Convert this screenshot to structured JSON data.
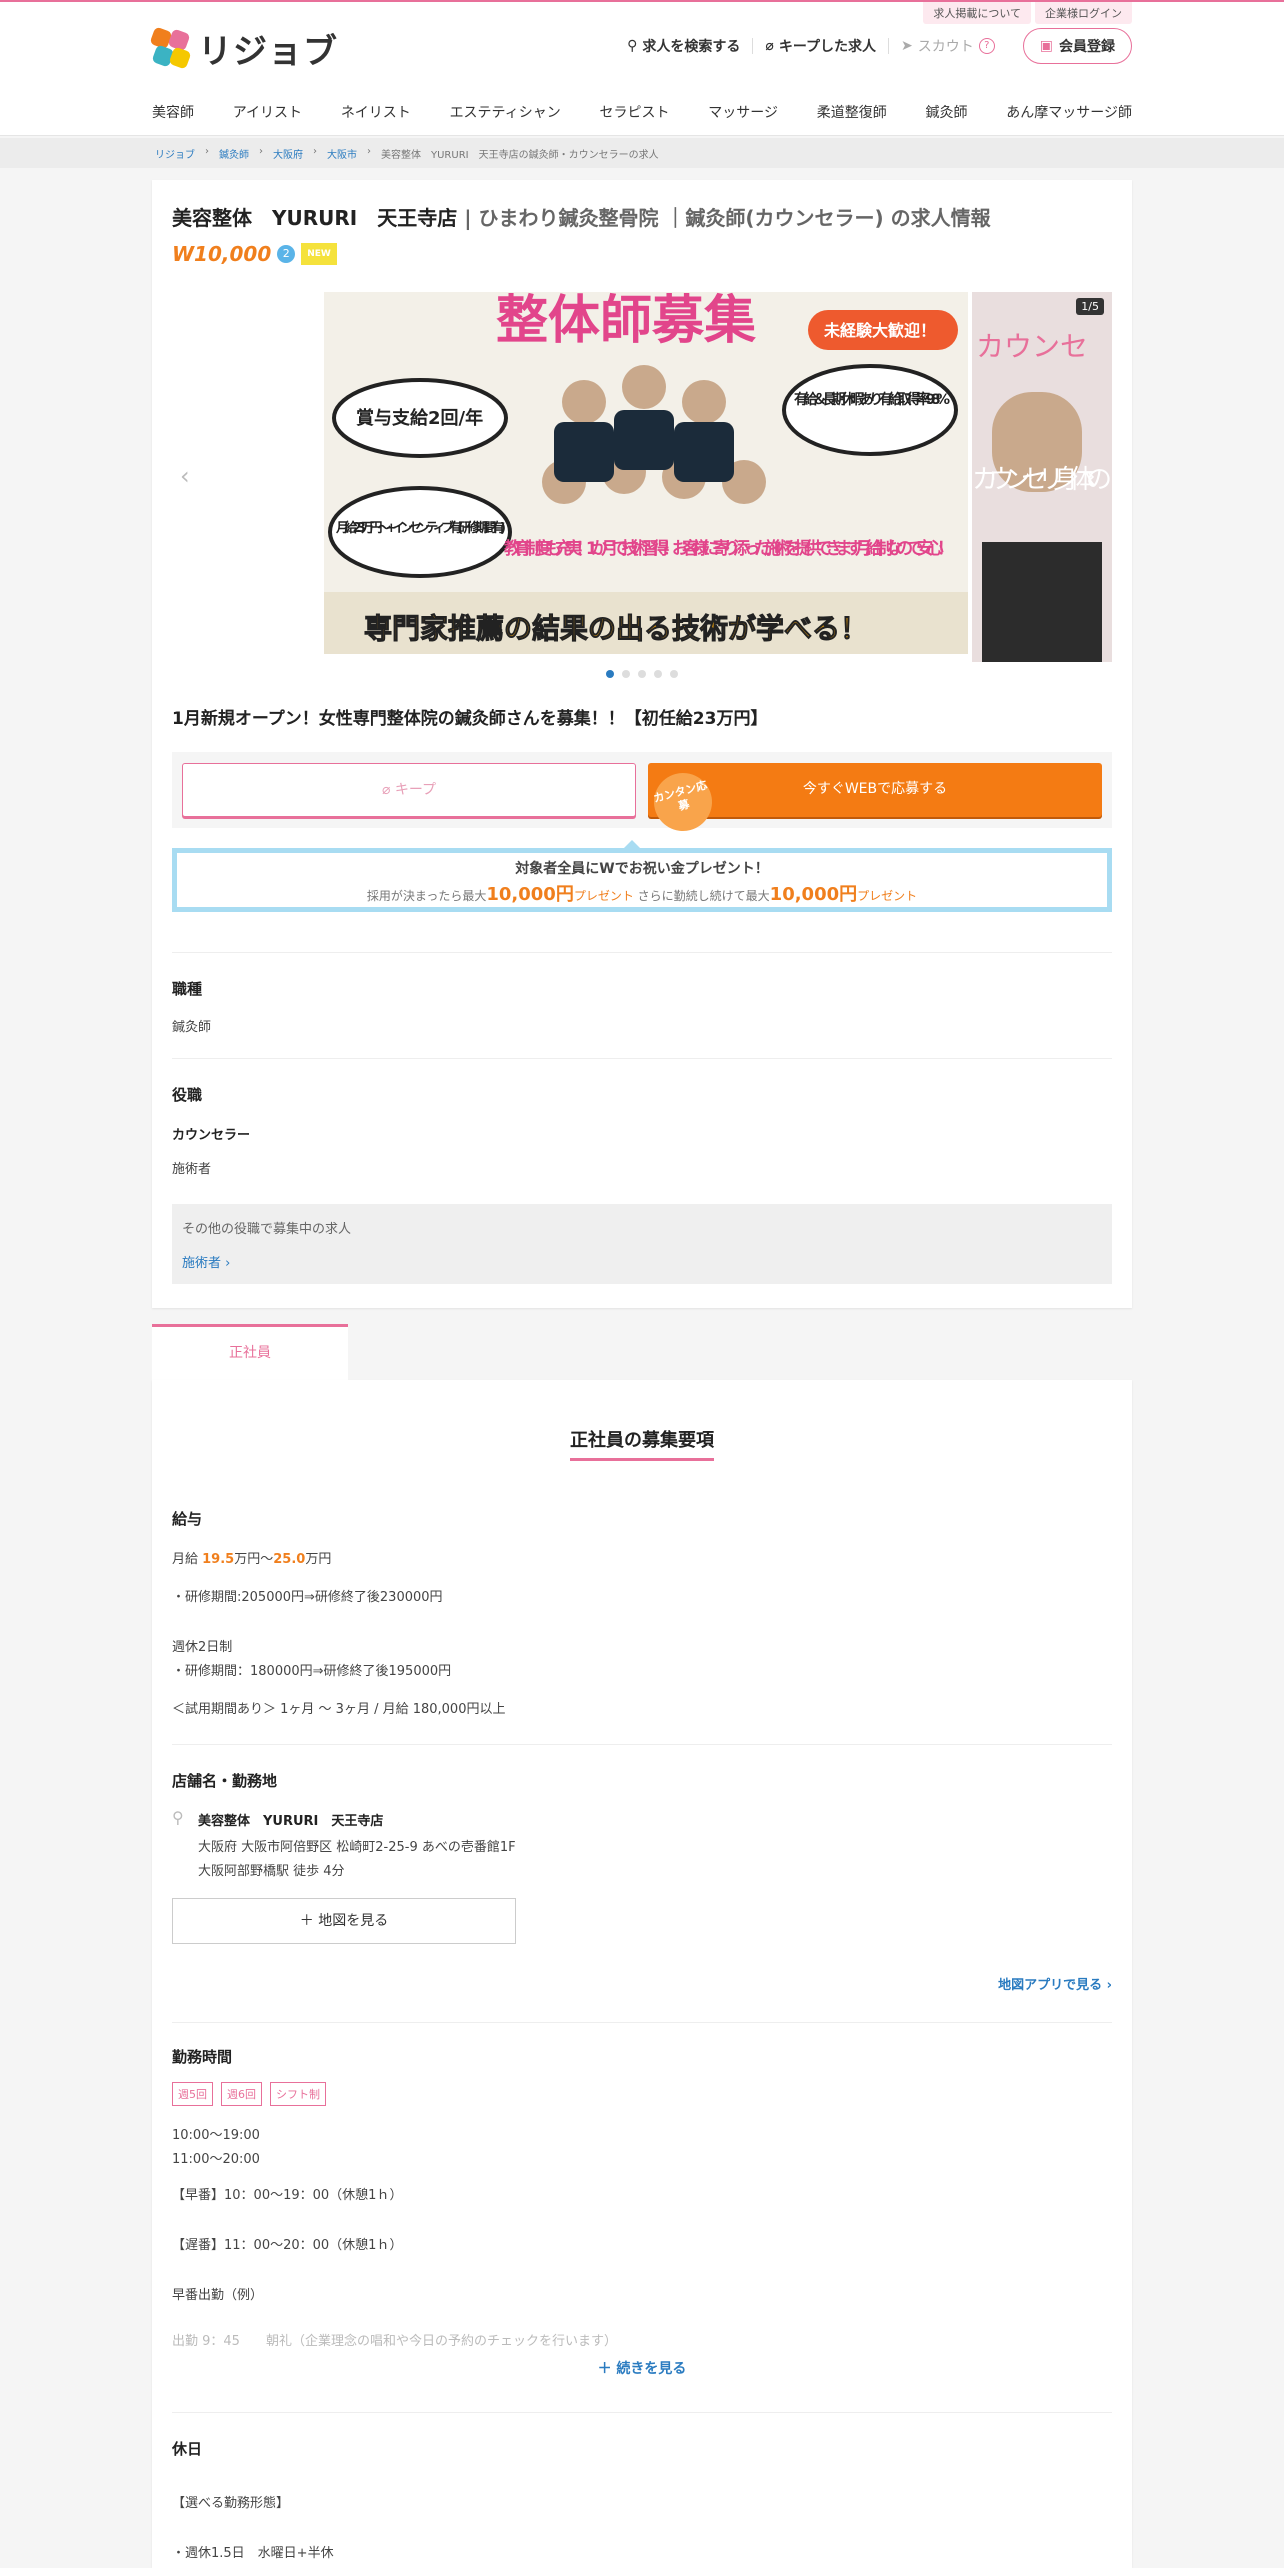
{
  "header": {
    "logo_text": "リジョブ",
    "util_links": [
      "求人掲載について",
      "企業様ログイン"
    ],
    "nav": {
      "search": "求人を検索する",
      "kept": "キープした求人",
      "scout": "スカウト",
      "scout_help": "?",
      "member": "会員登録"
    },
    "categories": [
      "美容師",
      "アイリスト",
      "ネイリスト",
      "エステティシャン",
      "セラピスト",
      "マッサージ",
      "柔道整復師",
      "鍼灸師",
      "あん摩マッサージ師"
    ]
  },
  "breadcrumb": [
    "リジョブ",
    "鍼灸師",
    "大阪府",
    "大阪市",
    "美容整体　YURURI　天王寺店の鍼灸師・カウンセラーの求人"
  ],
  "job": {
    "title_store": "美容整体　YURURI　天王寺店",
    "title_rest": "| ひまわり鍼灸整骨院 ｜鍼灸師(カウンセラー) の求人情報",
    "w_badge": "W10,000",
    "w_badge_num": "2",
    "new_badge": "NEW",
    "slide_counter": "1/5",
    "slide_texts": {
      "headline": "整体師募集",
      "inexp": "未経験大歓迎！",
      "bonus": "賞与支給2回/年",
      "holiday": "有給＆長期休暇あり 有給取得率98%",
      "salary": "月給23万円～ +インセンティブ有 (研修期間有)",
      "edu": "教育制度も充実！1か月で技術習得！ お客様に寄り添った施術を提供できます 月給制なので安心！",
      "bottom": "専門家推薦の結果の出る技術が学べる！",
      "side1": "カウンセ",
      "side2": "カウンセリ 身体の"
    },
    "catch": "1月新規オープン！女性専門整体院の鍼灸師さんを募集！！【初任給23万円】",
    "keep_label": "キープ",
    "apply_label": "今すぐWEBで応募する",
    "easy_label": "カンタン応募",
    "present": {
      "line1": "対象者全員にWでお祝い金プレゼント！",
      "a": "採用が決まったら最大",
      "amount1": "10,000円",
      "b": "プレゼント",
      "c": " さらに勤続し続けて最大",
      "amount2": "10,000円",
      "d": "プレゼント"
    },
    "shokushu_h": "職種",
    "shokushu": "鍼灸師",
    "yakushoku_h": "役職",
    "yakushoku_1": "カウンセラー",
    "yakushoku_2": "施術者",
    "other_roles_label": "その他の役職で募集中の求人",
    "other_roles_link": "施術者 ›"
  },
  "tab_label": "正社員",
  "details": {
    "section_title": "正社員の募集要項",
    "salary_h": "給与",
    "salary_pre": "月給 ",
    "salary_min": "19.5",
    "salary_mid": "万円〜",
    "salary_max": "25.0",
    "salary_post": "万円",
    "salary_lines": [
      "・研修期間:205000円⇒研修終了後230000円",
      "週休2日制",
      "・研修期間：180000円⇒研修終了後195000円",
      "＜試用期間あり＞ 1ヶ月 〜 3ヶ月 / 月給 180,000円以上"
    ],
    "store_h": "店舗名・勤務地",
    "store_name": "美容整体　YURURI　天王寺店",
    "store_address": "大阪府 大阪市阿倍野区 松崎町2-25-9 あべの壱番館1F",
    "store_access": "大阪阿部野橋駅 徒歩 4分",
    "map_button": "＋ 地図を見る",
    "map_app": "地図アプリで見る ›",
    "hours_h": "勤務時間",
    "hours_tags": [
      "週5回",
      "週6回",
      "シフト制"
    ],
    "hours_lines": [
      "10:00〜19:00",
      "11:00〜20:00",
      "【早番】10：00～19：00（休憩1ｈ）",
      "【遅番】11：00～20：00（休憩1ｈ）",
      "早番出勤（例）"
    ],
    "hours_fade": "出勤 9：45　　朝礼（企業理念の唱和や今日の予約のチェックを行います）",
    "more": "＋ 続きを見る",
    "holiday_h": "休日",
    "holiday_lines": [
      "【選べる勤務形態】",
      "・週休1.5日　水曜日+半休"
    ]
  }
}
